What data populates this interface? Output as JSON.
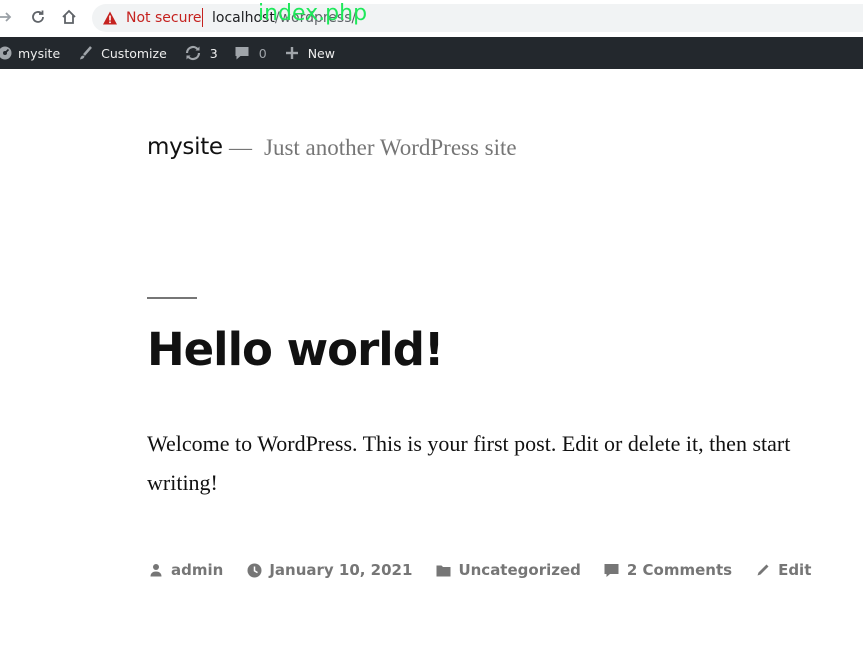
{
  "browser": {
    "security_label": "Not secure",
    "url_host": "localhost",
    "url_path": "/wordpress/",
    "url_overlay": "index.php"
  },
  "admin_bar": {
    "site_name": "mysite",
    "customize_label": "Customize",
    "updates_count": "3",
    "comments_count": "0",
    "new_label": "New"
  },
  "site": {
    "title": "mysite",
    "separator": "—",
    "tagline": "Just another WordPress site"
  },
  "post": {
    "title": "Hello world!",
    "content": "Welcome to WordPress. This is your first post. Edit or delete it, then start writing!",
    "meta": {
      "author": "admin",
      "date": "January 10, 2021",
      "category": "Uncategorized",
      "comments": "2 Comments",
      "edit": "Edit"
    }
  },
  "colors": {
    "admin_bar_bg": "#23282d",
    "not_secure": "#c5221f",
    "overlay_text": "#1ee85a",
    "meta_text": "#767676"
  }
}
